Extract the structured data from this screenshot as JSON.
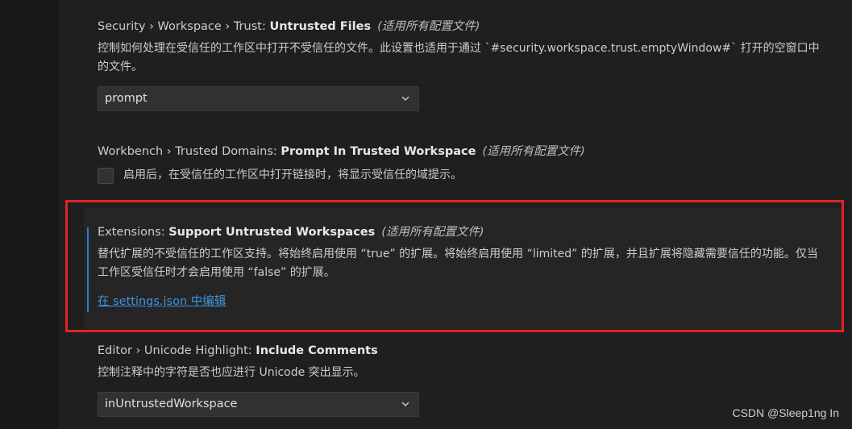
{
  "colors": {
    "background": "#1f1f1f",
    "focus_highlight_color": "#e02326",
    "link": "#3e94de",
    "focus_bar": "#2f7fc9"
  },
  "settings": [
    {
      "category": "Security › Workspace › Trust: ",
      "name": "Untrusted Files",
      "scope": "(适用所有配置文件)",
      "description": "控制如何处理在受信任的工作区中打开不受信任的文件。此设置也适用于通过 `#security.workspace.trust.emptyWindow#` 打开的空窗口中的文件。",
      "control": "dropdown",
      "value": "prompt"
    },
    {
      "category": "Workbench › Trusted Domains: ",
      "name": "Prompt In Trusted Workspace",
      "scope": "(适用所有配置文件)",
      "checkbox_label": "启用后，在受信任的工作区中打开链接时，将显示受信任的域提示。",
      "control": "checkbox",
      "checked": false
    },
    {
      "category": "Extensions: ",
      "name": "Support Untrusted Workspaces",
      "scope": "(适用所有配置文件)",
      "description": "替代扩展的不受信任的工作区支持。将始终启用使用 “true” 的扩展。将始终启用使用 “limited” 的扩展，并且扩展将隐藏需要信任的功能。仅当工作区受信任时才会启用使用 “false” 的扩展。",
      "link": "在 settings.json 中编辑"
    },
    {
      "category": "Editor › Unicode Highlight: ",
      "name": "Include Comments",
      "description": "控制注释中的字符是否也应进行 Unicode 突出显示。",
      "control": "dropdown",
      "value": "inUntrustedWorkspace"
    }
  ],
  "watermark": "CSDN @Sleep1ng In"
}
